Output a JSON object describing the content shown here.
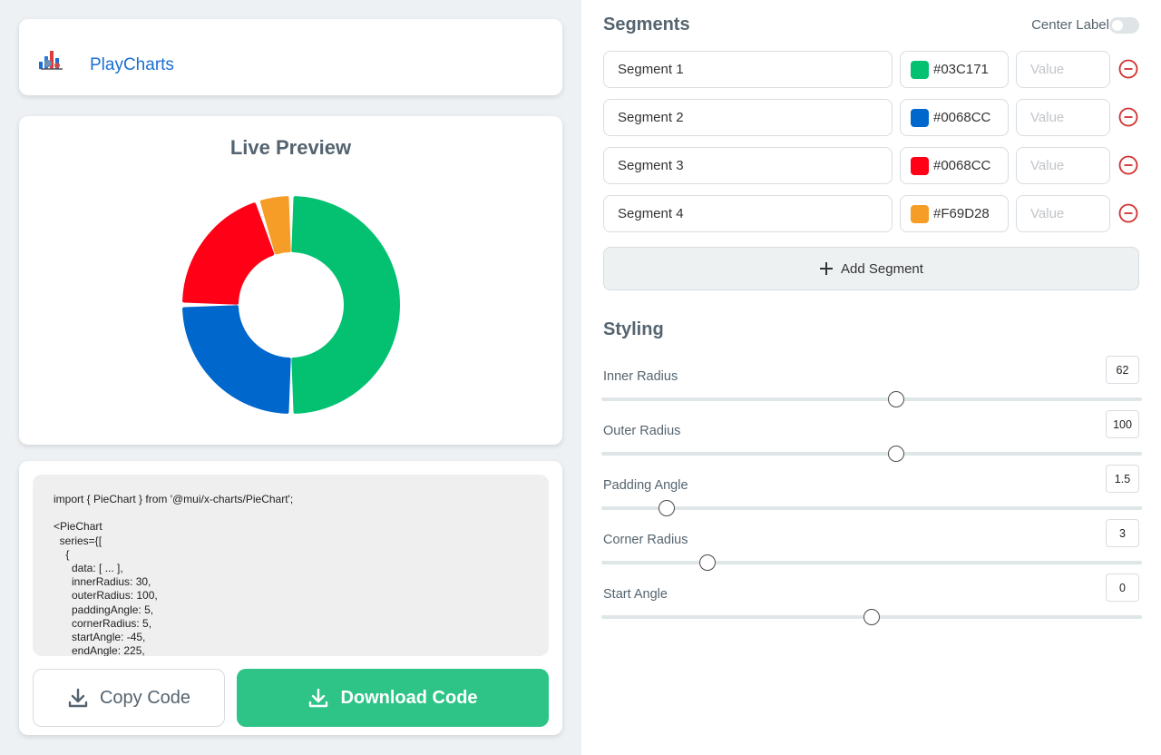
{
  "header": {
    "brand": "PlayCharts"
  },
  "preview": {
    "title": "Live Preview",
    "chart_data": {
      "type": "pie",
      "values": [
        50,
        25,
        20,
        5
      ],
      "colors": [
        "#03C171",
        "#0068CC",
        "#FF0016",
        "#F69D28"
      ]
    }
  },
  "code": {
    "text": "import { PieChart } from '@mui/x-charts/PieChart';\n\n<PieChart\n  series={[\n    {\n      data: [ ... ],\n      innerRadius: 30,\n      outerRadius: 100,\n      paddingAngle: 5,\n      cornerRadius: 5,\n      startAngle: -45,\n      endAngle: 225,",
    "copy_label": "Copy Code",
    "download_label": "Download Code"
  },
  "segments": {
    "title": "Segments",
    "center_label": "Center Label",
    "center_label_on": false,
    "items": [
      {
        "name": "Segment 1",
        "color_hex": "#03C171",
        "swatch": "#03C171",
        "value_placeholder": "Value"
      },
      {
        "name": "Segment 2",
        "color_hex": "#0068CC",
        "swatch": "#0068CC",
        "value_placeholder": "Value"
      },
      {
        "name": "Segment 3",
        "color_hex": "#0068CC",
        "swatch": "#FF0016",
        "value_placeholder": "Value"
      },
      {
        "name": "Segment 4",
        "color_hex": "#F69D28",
        "swatch": "#F69D28",
        "value_placeholder": "Value"
      }
    ],
    "add_label": "Add Segment"
  },
  "styling": {
    "title": "Styling",
    "sliders": [
      {
        "label": "Inner Radius",
        "value": "62",
        "position": 0.545
      },
      {
        "label": "Outer Radius",
        "value": "100",
        "position": 0.545
      },
      {
        "label": "Padding Angle",
        "value": "1.5",
        "position": 0.12
      },
      {
        "label": "Corner Radius",
        "value": "3",
        "position": 0.196
      },
      {
        "label": "Start Angle",
        "value": "0",
        "position": 0.5
      }
    ]
  }
}
